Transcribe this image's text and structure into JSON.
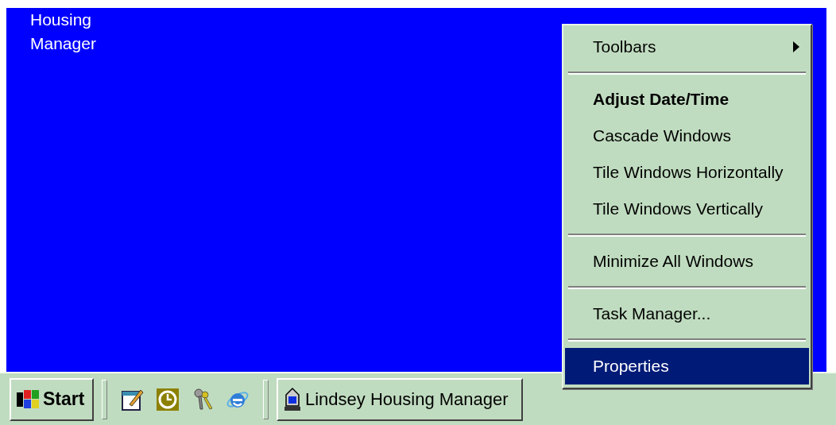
{
  "desktop": {
    "icons": [
      {
        "label": "Housing Manager"
      }
    ]
  },
  "taskbar": {
    "start_button": {
      "label": "Start"
    },
    "tasks": [
      {
        "label": "Lindsey Housing Manager",
        "selected": false
      }
    ]
  },
  "context_menu": {
    "items": [
      {
        "kind": "item",
        "label": "Toolbars",
        "bold": false,
        "submenu": true,
        "selected": false
      },
      {
        "kind": "separator"
      },
      {
        "kind": "item",
        "label": "Adjust Date/Time",
        "bold": true,
        "submenu": false,
        "selected": false
      },
      {
        "kind": "item",
        "label": "Cascade Windows",
        "bold": false,
        "submenu": false,
        "selected": false
      },
      {
        "kind": "item",
        "label": "Tile Windows Horizontally",
        "bold": false,
        "submenu": false,
        "selected": false
      },
      {
        "kind": "item",
        "label": "Tile Windows Vertically",
        "bold": false,
        "submenu": false,
        "selected": false
      },
      {
        "kind": "separator"
      },
      {
        "kind": "item",
        "label": "Minimize All Windows",
        "bold": false,
        "submenu": false,
        "selected": false
      },
      {
        "kind": "separator"
      },
      {
        "kind": "item",
        "label": "Task Manager...",
        "bold": false,
        "submenu": false,
        "selected": false
      },
      {
        "kind": "separator"
      },
      {
        "kind": "item",
        "label": "Properties",
        "bold": false,
        "submenu": false,
        "selected": true
      }
    ]
  }
}
